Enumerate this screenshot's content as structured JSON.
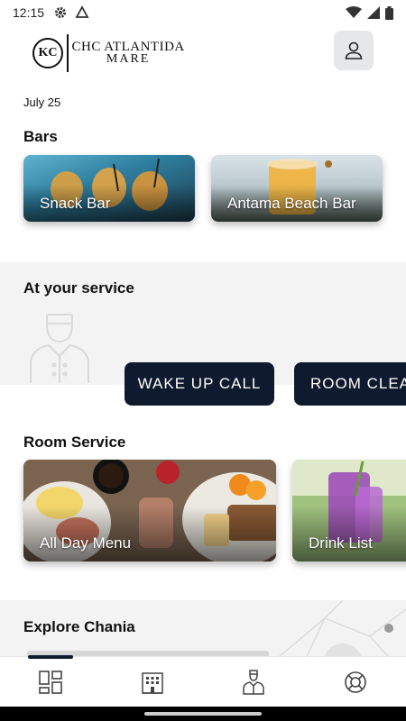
{
  "status_bar": {
    "time": "12:15"
  },
  "header": {
    "logo_mark": "KC",
    "logo_line1": "CHC ATLANTIDA",
    "logo_line2": "MARE"
  },
  "date": "July 25",
  "bars": {
    "title": "Bars",
    "items": [
      {
        "label": "Snack Bar"
      },
      {
        "label": "Antama Beach Bar"
      }
    ]
  },
  "service": {
    "title": "At your service",
    "buttons": [
      {
        "label": "WAKE UP CALL"
      },
      {
        "label": "ROOM CLEA"
      }
    ]
  },
  "room_service": {
    "title": "Room Service",
    "items": [
      {
        "label": "All Day Menu"
      },
      {
        "label": "Drink List"
      }
    ]
  },
  "explore": {
    "title": "Explore Chania"
  },
  "bottom_nav": {
    "items": [
      {
        "icon": "dashboard-icon"
      },
      {
        "icon": "hotel-building-icon"
      },
      {
        "icon": "concierge-icon"
      },
      {
        "icon": "lifebuoy-icon"
      }
    ]
  },
  "colors": {
    "accent": "#0f1a2e",
    "band": "#f3f3f3"
  }
}
